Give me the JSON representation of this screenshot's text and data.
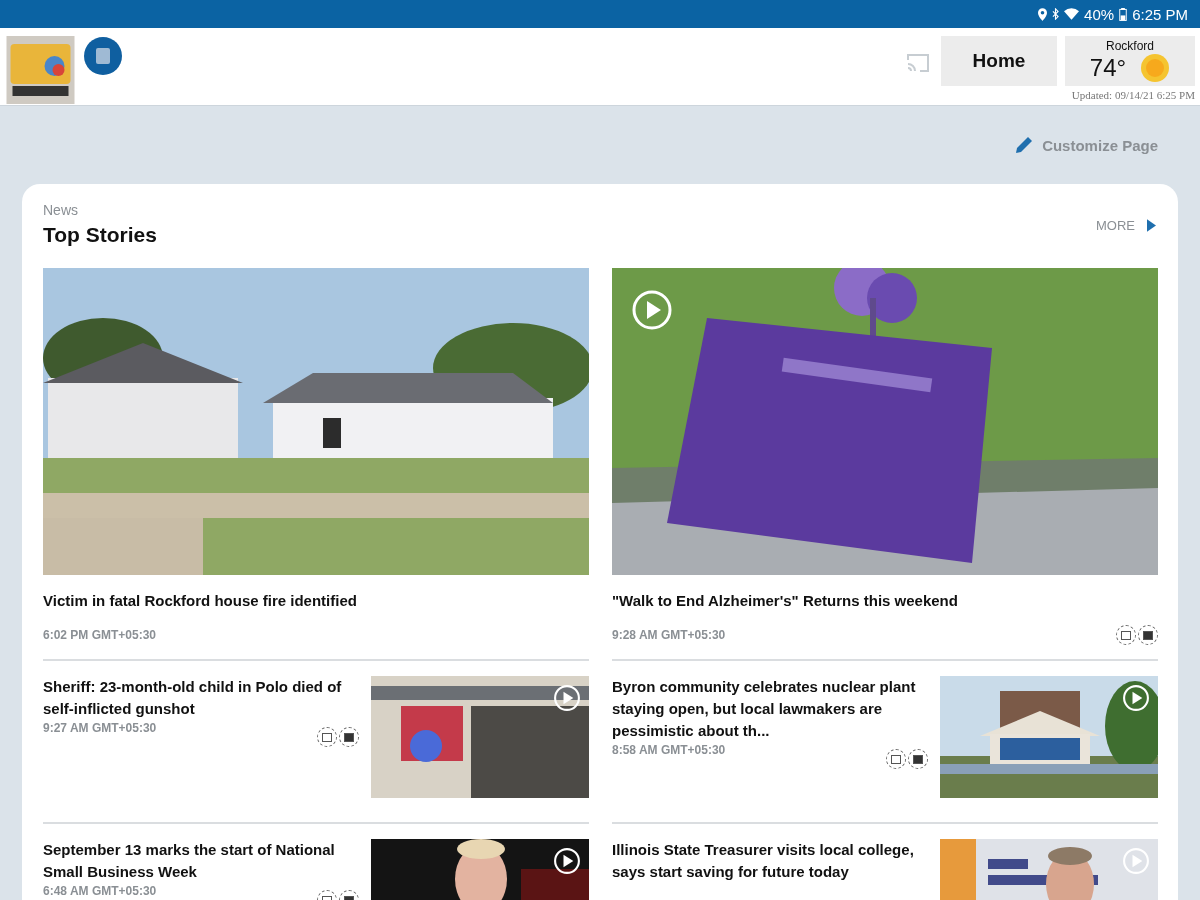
{
  "status_bar": {
    "battery": "40%",
    "time": "6:25 PM"
  },
  "header": {
    "home_button": "Home",
    "weather": {
      "city": "Rockford",
      "temperature": "74°",
      "updated": "Updated: 09/14/21 6:25 PM"
    }
  },
  "customize": "Customize Page",
  "section": {
    "category": "News",
    "title": "Top Stories",
    "more": "MORE"
  },
  "featured": [
    {
      "title": "Victim in fatal Rockford house fire identified",
      "time": "6:02 PM GMT+05:30",
      "video": false,
      "actions": false
    },
    {
      "title": "\"Walk to End Alzheimer's\" Returns this weekend",
      "time": "9:28 AM GMT+05:30",
      "video": true,
      "actions": true
    }
  ],
  "stories": [
    {
      "title": "Sheriff: 23-month-old child in Polo died of self-inflicted gunshot",
      "time": "9:27 AM GMT+05:30",
      "video": true,
      "actions": true
    },
    {
      "title": "Byron community celebrates nuclear plant staying open, but local lawmakers are pessimistic about th...",
      "time": "8:58 AM GMT+05:30",
      "video": true,
      "actions": true
    },
    {
      "title": "September 13 marks the start of National Small Business Week",
      "time": "6:48 AM GMT+05:30",
      "video": true,
      "actions": true
    },
    {
      "title": "Illinois State Treasurer visits local college, says start saving for future today",
      "video": true,
      "actions": false
    }
  ]
}
